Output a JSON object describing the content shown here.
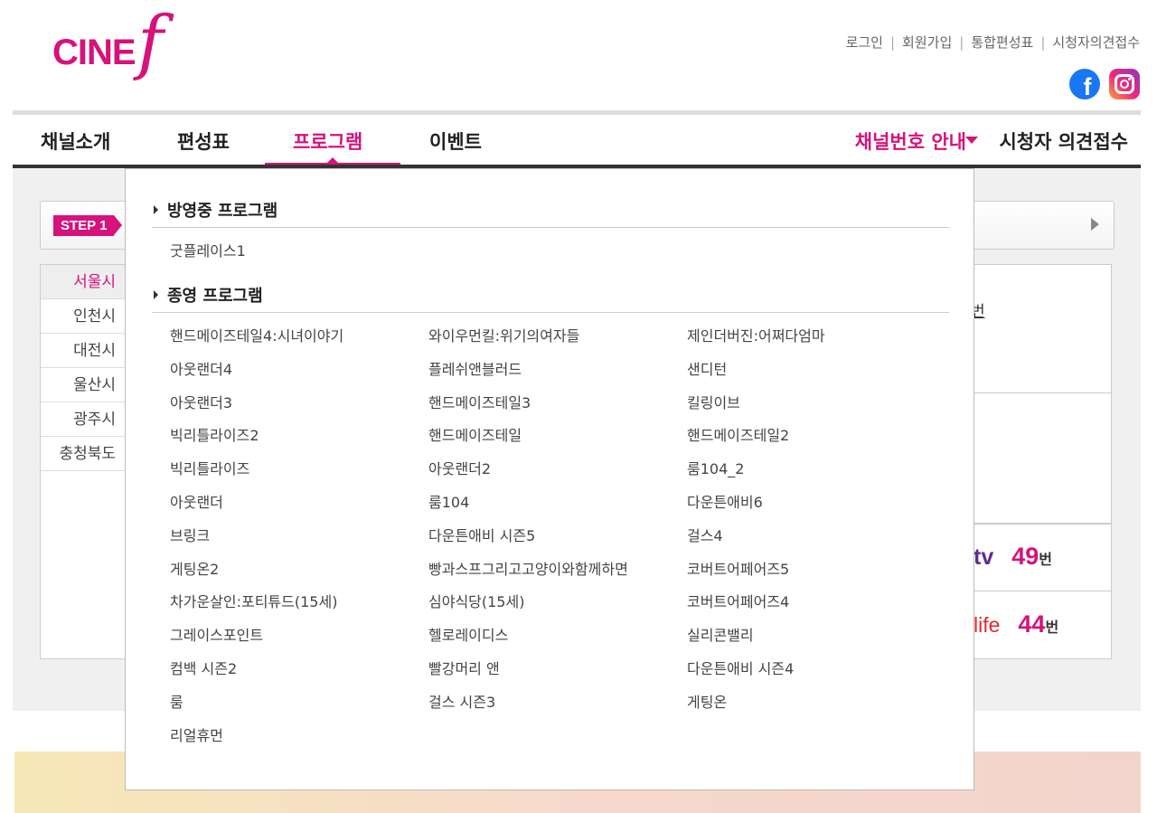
{
  "brand": {
    "logo_text": "CINE",
    "logo_f": "f",
    "color": "#d6127b"
  },
  "top_links": [
    "로그인",
    "회원가입",
    "통합편성표",
    "시청자의견접수"
  ],
  "sns": {
    "facebook_glyph": "f"
  },
  "gnb": {
    "items": [
      "채널소개",
      "편성표",
      "프로그램",
      "이벤트"
    ],
    "active_index": 2,
    "channel_guide": "채널번호 안내",
    "feedback": "시청자 의견접수"
  },
  "step": {
    "badge": "STEP 1"
  },
  "regions": [
    "서울시",
    "인천시",
    "대전시",
    "울산시",
    "광주시",
    "충청북도"
  ],
  "active_region": "서울시",
  "right_panel": {
    "beon": "번",
    "channels": [
      {
        "logo": "tv",
        "number": "49",
        "unit": "번"
      },
      {
        "logo": "life",
        "number": "44",
        "unit": "번"
      }
    ]
  },
  "dropdown": {
    "on_air_heading": "방영중 프로그램",
    "on_air": [
      "굿플레이스1"
    ],
    "ended_heading": "종영 프로그램",
    "ended_columns": [
      [
        "핸드메이즈테일4:시녀이야기",
        "아웃랜더4",
        "아웃랜더3",
        "빅리틀라이즈2",
        "빅리틀라이즈",
        "아웃랜더",
        "브링크",
        "게팅온2",
        "차가운살인:포티튜드(15세)",
        "그레이스포인트",
        "컴백 시즌2",
        "룸",
        "리얼휴먼"
      ],
      [
        "와이우먼킬:위기의여자들",
        "플레쉬앤블러드",
        "핸드메이즈테일3",
        "핸드메이즈테일",
        "아웃랜더2",
        "룸104",
        "다운튼애비 시즌5",
        "빵과스프그리고고양이와함께하면",
        "심야식당(15세)",
        "헬로레이디스",
        "빨강머리 앤",
        "걸스 시즌3"
      ],
      [
        "제인더버진:어쩌다엄마",
        "샌디턴",
        "킬링이브",
        "핸드메이즈테일2",
        "룸104_2",
        "다운튼애비6",
        "걸스4",
        "코버트어페어즈5",
        "코버트어페어즈4",
        "실리콘밸리",
        "다운튼애비 시즌4",
        "게팅온"
      ]
    ]
  }
}
